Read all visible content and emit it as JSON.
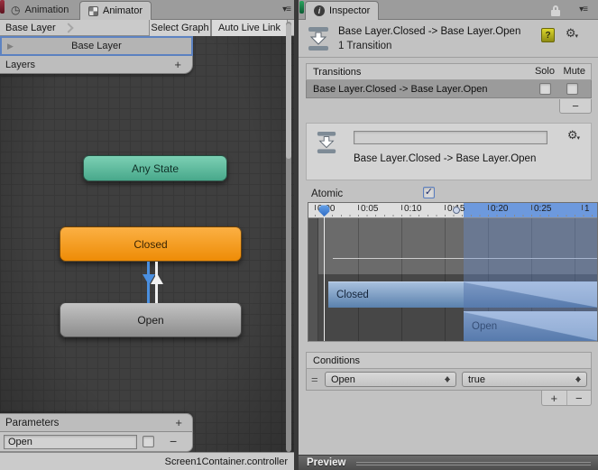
{
  "colors": {
    "accent_blue": "#3f7ed6",
    "selection_border_blue": "#5d83c2",
    "node_orange": "#f49b1c",
    "node_teal": "#5fbfa0",
    "node_gray": "#a8a8a8",
    "clip_blue": "#7ba3d0",
    "graph_background": "#3f3f3f",
    "inspector_background": "#c2c2c2"
  },
  "icons": {
    "clock": "◷",
    "pane_menu": "▾≡",
    "play": "▶",
    "gear": "⚙",
    "caret": "▾",
    "help": "?",
    "info": "i",
    "check": "✓",
    "plus": "+",
    "minus": "−",
    "equals": "="
  },
  "animator": {
    "tabs": [
      {
        "label": "Animation"
      },
      {
        "label": "Animator"
      }
    ],
    "breadcrumb": "Base Layer",
    "toolbar": {
      "select_graph": "Select Graph",
      "auto_live_link": "Auto Live Link"
    },
    "selected_layer": "Base Layer",
    "layers_label": "Layers",
    "nodes": {
      "any_state": "Any State",
      "closed": "Closed",
      "open": "Open"
    },
    "parameters": {
      "header": "Parameters",
      "param_name": "Open"
    },
    "status": "Screen1Container.controller"
  },
  "inspector": {
    "tab": "Inspector",
    "header": {
      "title": "Base Layer.Closed -> Base Layer.Open",
      "subtitle": "1 Transition"
    },
    "transitions": {
      "title": "Transitions",
      "solo": "Solo",
      "mute": "Mute",
      "rows": [
        {
          "label": "Base Layer.Closed -> Base Layer.Open"
        }
      ]
    },
    "detail": {
      "name_value": "",
      "label": "Base Layer.Closed -> Base Layer.Open"
    },
    "atomic_label": "Atomic",
    "timeline": {
      "ticks": [
        "0:00",
        "0:05",
        "0:10",
        "0:15",
        "0:20",
        "0:25",
        "1"
      ],
      "source_clip": "Closed",
      "dest_clip": "Open"
    },
    "conditions": {
      "title": "Conditions",
      "rows": [
        {
          "parameter": "Open",
          "value": "true"
        }
      ]
    },
    "preview": "Preview"
  }
}
